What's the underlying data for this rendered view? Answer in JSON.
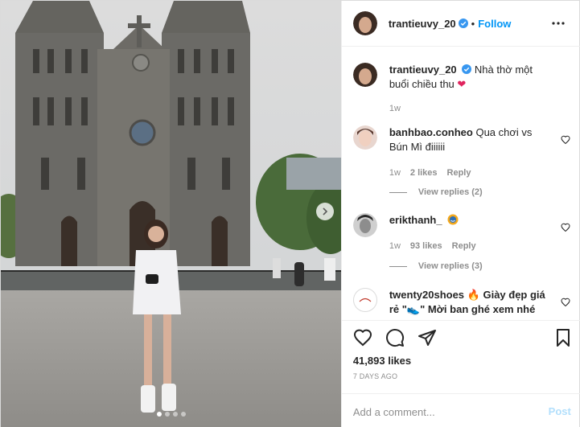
{
  "header": {
    "username": "trantieuvy_20",
    "separator": "•",
    "follow_label": "Follow"
  },
  "caption": {
    "username": "trantieuvy_20",
    "text": "Nhà thờ một buổi chiều thu",
    "emoji": "❤",
    "time": "1w"
  },
  "comments": [
    {
      "username": "banhbao.conheo",
      "text": "Qua chơi vs Bún Mì điiiiii",
      "time": "1w",
      "likes": "2 likes",
      "reply_label": "Reply",
      "view_replies": "View replies (2)"
    },
    {
      "username": "erikthanh_",
      "text": "",
      "time": "1w",
      "likes": "93 likes",
      "reply_label": "Reply",
      "view_replies": "View replies (3)"
    },
    {
      "username": "twenty20shoes",
      "text": "Giày đẹp giá rẻ \"👟\" Mời ban ghé xem nhé",
      "avatar_text": "TWENTY SHOES"
    }
  ],
  "actions": {
    "likes": "41,893 likes",
    "date": "7 DAYS AGO",
    "comment_placeholder": "Add a comment...",
    "post_label": "Post"
  },
  "carousel": {
    "total": 4,
    "active_index": 0
  },
  "colors": {
    "accent": "#0095f6",
    "verified": "#3897f0",
    "text": "#262626",
    "muted": "#8e8e8e"
  }
}
